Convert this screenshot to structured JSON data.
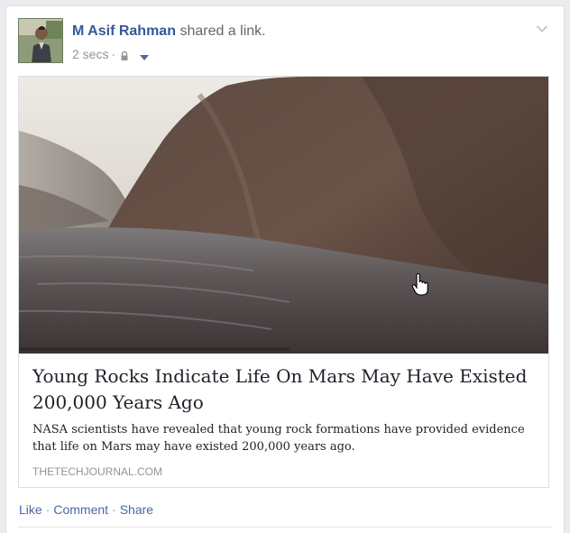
{
  "post": {
    "author": "M Asif Rahman",
    "action": "shared a link.",
    "timestamp": "2 secs",
    "meta_separator": "·",
    "privacy_icon": "lock-icon",
    "audience_icon": "caret-down-icon",
    "options_icon": "chevron-down-icon"
  },
  "link_preview": {
    "image_alt": "Rocky cliff beside water on Mars",
    "title": "Young Rocks Indicate Life On Mars May Have Existed 200,000 Years Ago",
    "description": "NASA scientists have revealed that young rock formations have provided evidence that life on Mars may have existed 200,000 years ago.",
    "domain": "THETECHJOURNAL.COM"
  },
  "actions": {
    "like": "Like",
    "comment": "Comment",
    "share": "Share",
    "separator": "·"
  },
  "colors": {
    "author_link": "#365899",
    "action_link": "#4b67a1",
    "meta_text": "#90949c"
  }
}
